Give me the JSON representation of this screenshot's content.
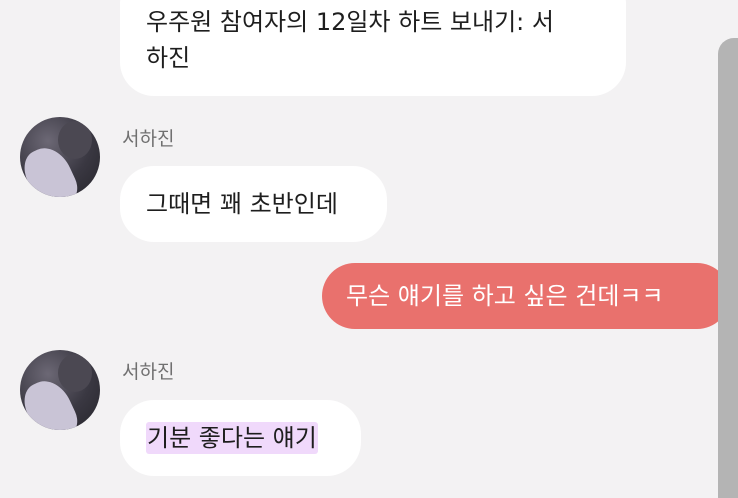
{
  "messages": [
    {
      "type": "system",
      "text_line1": "우주원 참여자의 12일차 하트 보내기: 서",
      "text_line2": "하진"
    },
    {
      "type": "incoming",
      "sender": "서하진",
      "text": "그때면 꽤 초반인데"
    },
    {
      "type": "outgoing",
      "text": "무슨 얘기를 하고 싶은 건데ㅋㅋ"
    },
    {
      "type": "incoming",
      "sender": "서하진",
      "text": "기분 좋다는 얘기"
    }
  ],
  "colors": {
    "background": "#f3f2f3",
    "incoming_bubble": "#ffffff",
    "outgoing_bubble": "#e9716d",
    "highlight": "#f0d9fb",
    "side_panel": "#b4b4b4"
  }
}
